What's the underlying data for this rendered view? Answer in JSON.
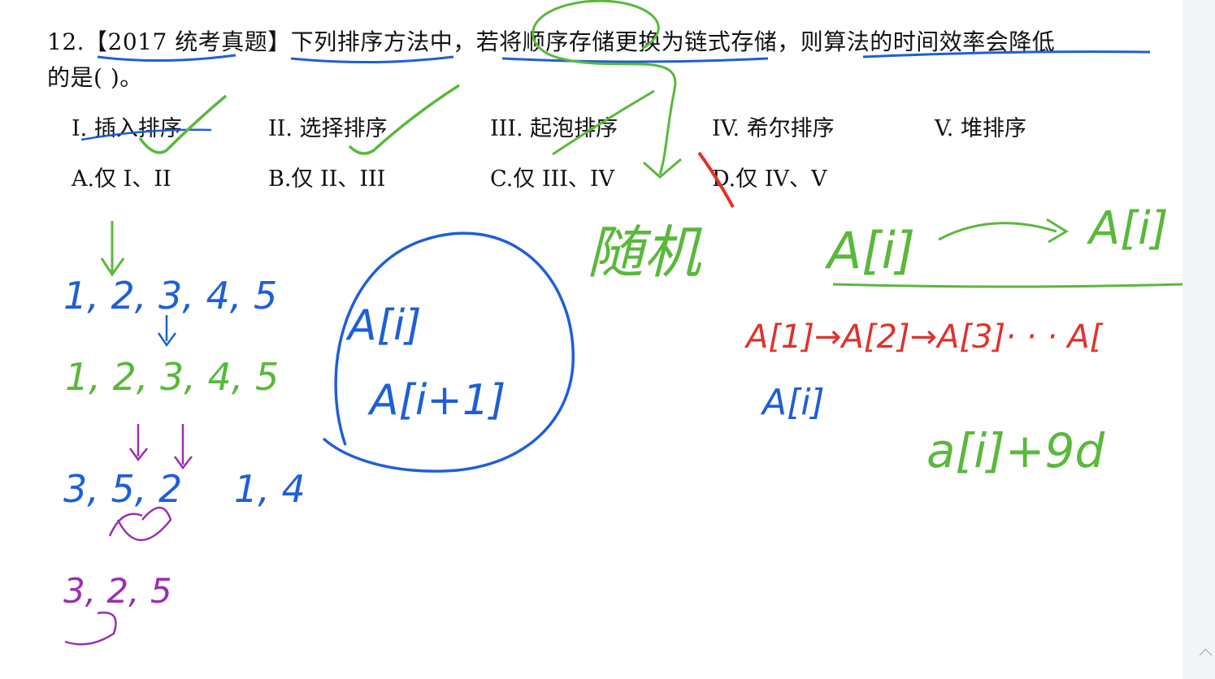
{
  "question": {
    "line1": "12.【2017 统考真题】下列排序方法中，若将顺序存储更换为链式存储，则算法的时间效率会降低",
    "line2": "的是(      )。"
  },
  "items": [
    "I.  插入排序",
    "II.  选择排序",
    "III.  起泡排序",
    "IV.  希尔排序",
    "V.  堆排序"
  ],
  "options": [
    "A.仅 I、II",
    "B.仅 II、III",
    "C.仅 III、IV",
    "D.仅 IV、V"
  ],
  "annotations": {
    "random": "随机",
    "a_first": "A[i]",
    "a_jump": "A[i]",
    "chain": "A[1]→A[2]→A[3]· · · A[",
    "a_i_red_under": "A[i]",
    "formula": "a[i]+9d",
    "circle_top": "A[i]",
    "circle_bottom": "A[i+1]",
    "seq1": "1, 2, 3, 4, 5",
    "seq2": "1, 2, 3, 4, 5",
    "seq3a": "3, 5, 2",
    "seq3b": "1, 4",
    "seq4": "3, 2, 5"
  },
  "colors": {
    "green": "#5ab83c",
    "blue": "#1f5fd6",
    "red": "#e0322a",
    "purple": "#9a2fb0"
  }
}
